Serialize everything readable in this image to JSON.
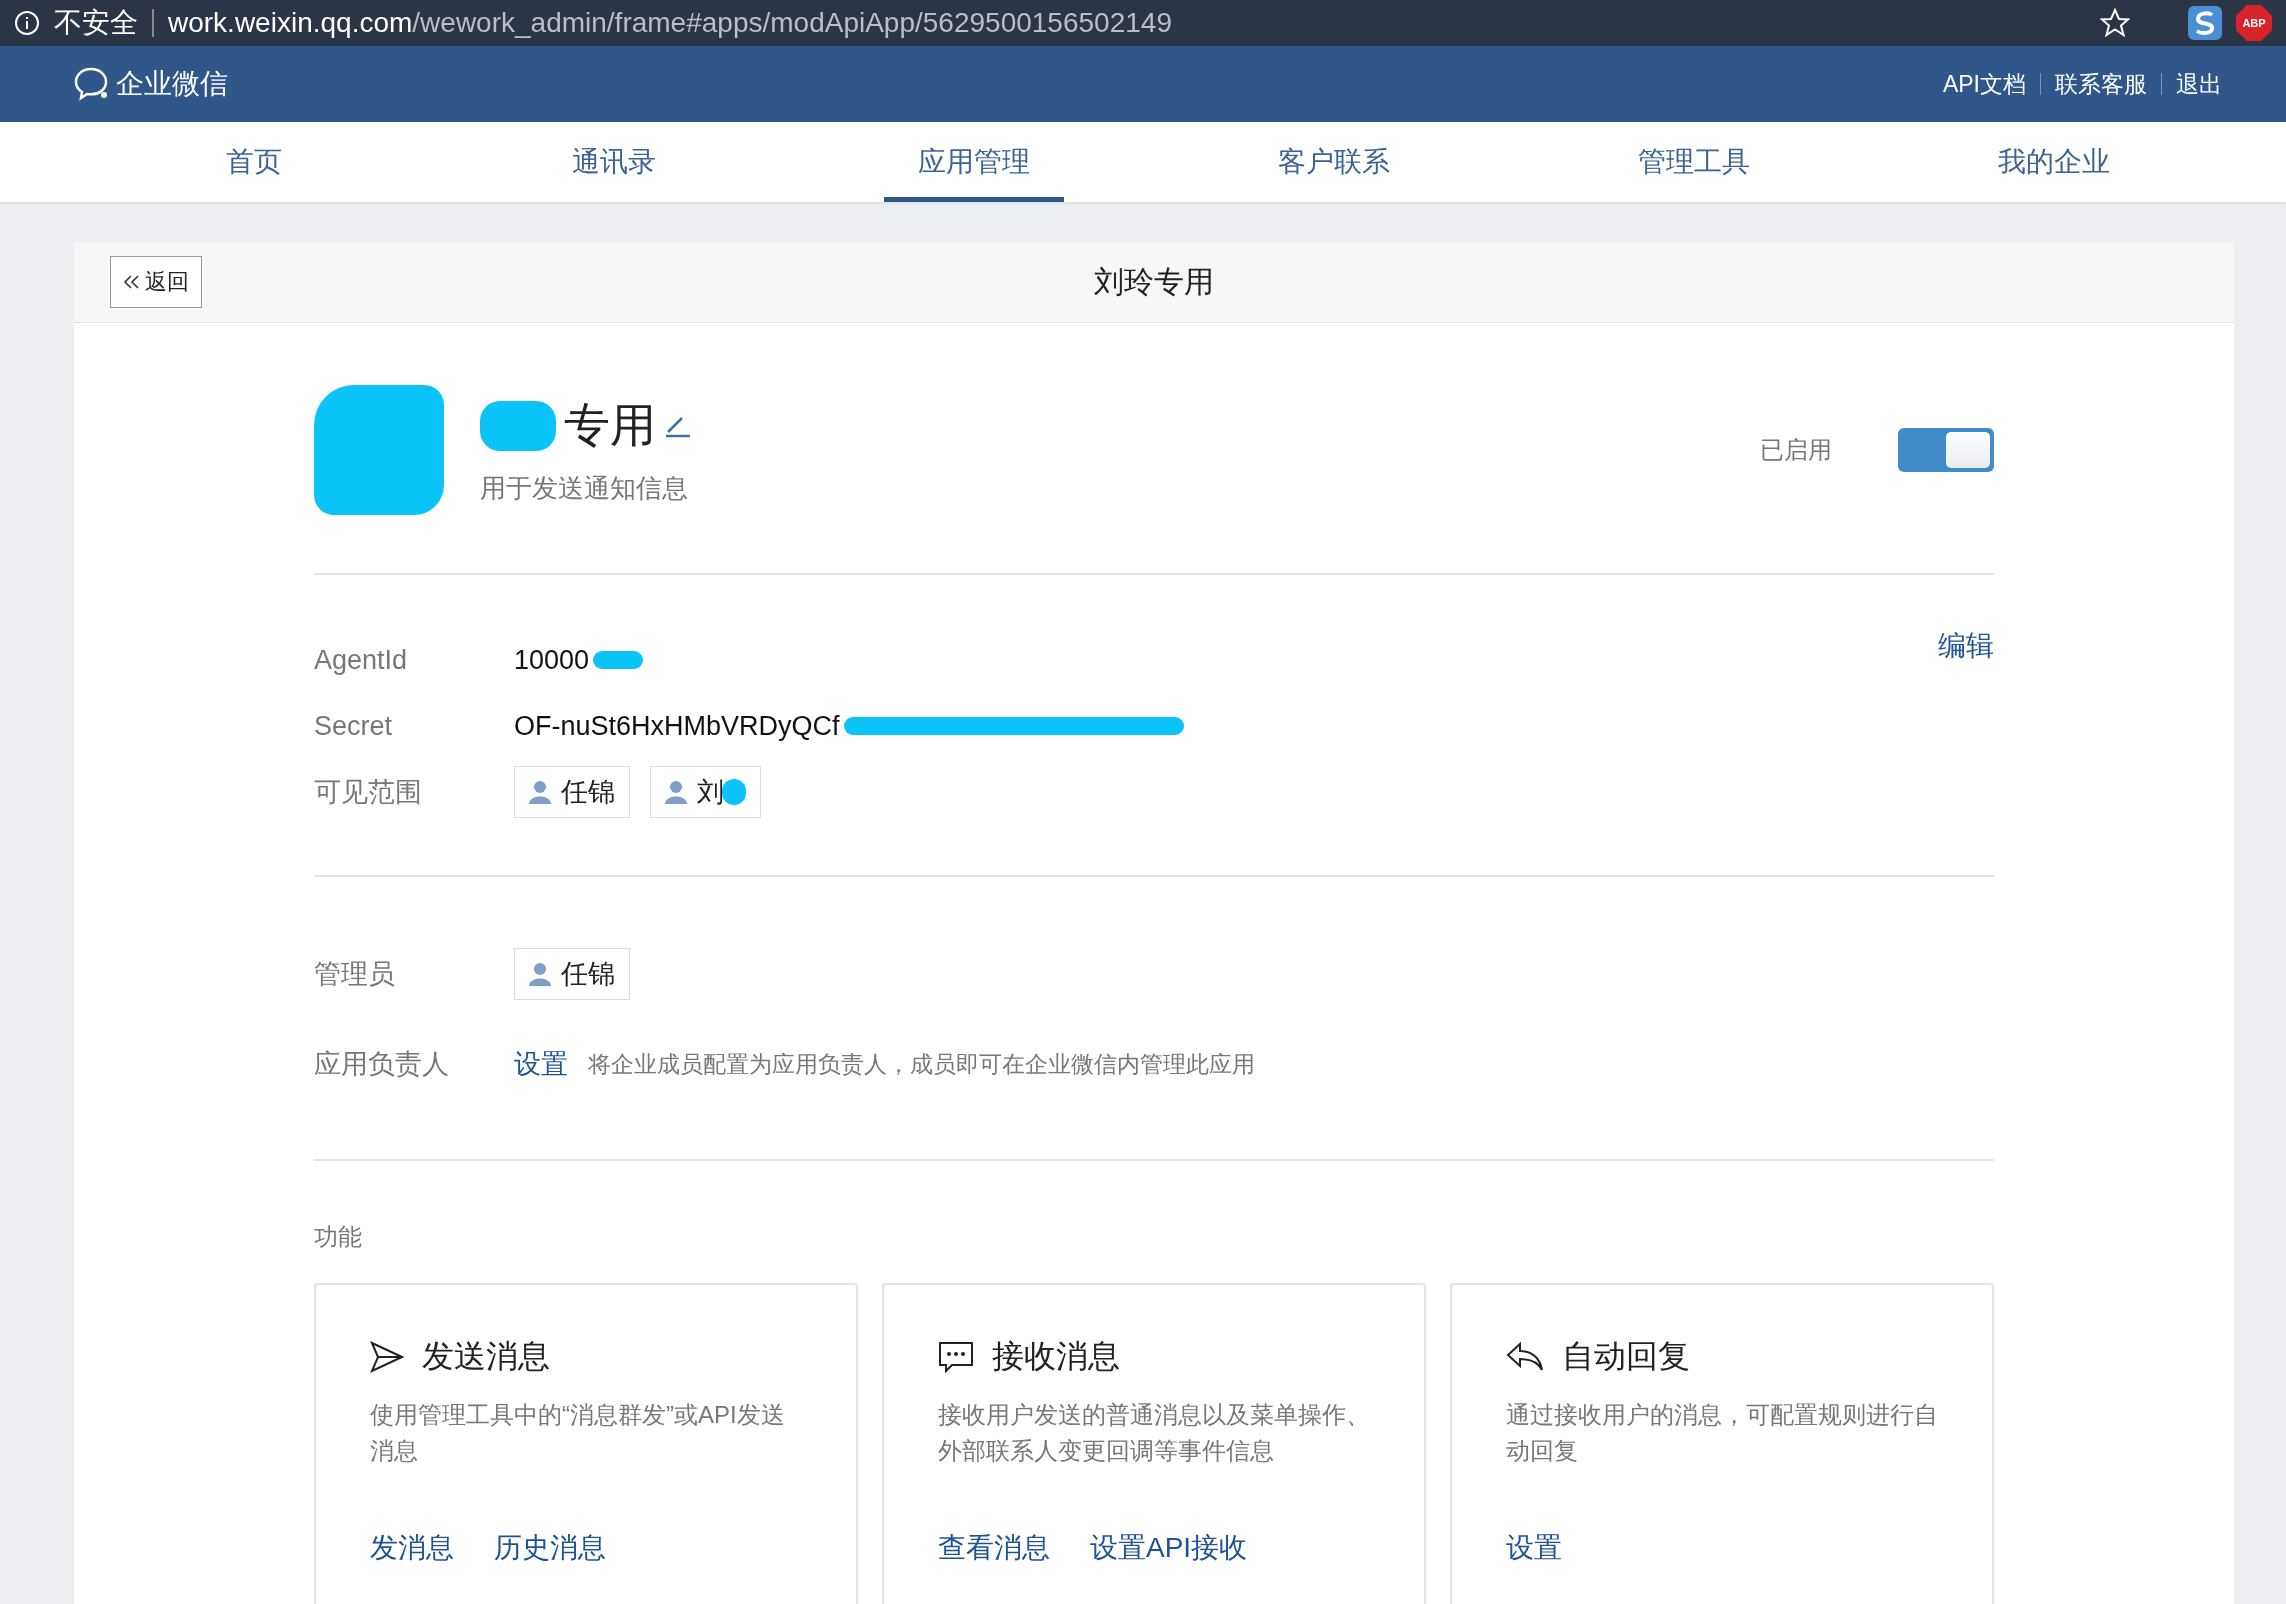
{
  "browser": {
    "security": "不安全",
    "url_host": "work.weixin.qq.com",
    "url_path": "/wework_admin/frame#apps/modApiApp/5629500156502149",
    "extension_badge": "ABP"
  },
  "header": {
    "logo_text": "企业微信",
    "links": [
      "API文档",
      "联系客服",
      "退出"
    ]
  },
  "nav": [
    {
      "label": "首页",
      "selected": false
    },
    {
      "label": "通讯录",
      "selected": false
    },
    {
      "label": "应用管理",
      "selected": true
    },
    {
      "label": "客户联系",
      "selected": false
    },
    {
      "label": "管理工具",
      "selected": false
    },
    {
      "label": "我的企业",
      "selected": false
    }
  ],
  "card": {
    "back": "返回",
    "title": "刘玲专用"
  },
  "app": {
    "name": "专用",
    "description": "用于发送通知信息",
    "status_label": "已启用",
    "enabled": true
  },
  "details": {
    "edit": "编辑",
    "rows": [
      {
        "kind": "text",
        "label": "AgentId",
        "value": "10000"
      },
      {
        "kind": "text",
        "label": "Secret",
        "value": "OF-nuSt6HxHMbVRDyQCf"
      },
      {
        "kind": "members",
        "label": "可见范围",
        "members": [
          "任锦",
          "刘"
        ]
      }
    ]
  },
  "management": {
    "rows": [
      {
        "kind": "members",
        "label": "管理员",
        "members": [
          "任锦"
        ]
      },
      {
        "kind": "setting",
        "label": "应用负责人",
        "link": "设置",
        "hint": "将企业成员配置为应用负责人，成员即可在企业微信内管理此应用"
      }
    ]
  },
  "features": {
    "title": "功能",
    "cards": [
      {
        "kind": "send",
        "title": "发送消息",
        "description": "使用管理工具中的“消息群发”或API发送消息",
        "links": [
          "发消息",
          "历史消息"
        ]
      },
      {
        "kind": "chat",
        "title": "接收消息",
        "description": "接收用户发送的普通消息以及菜单操作、外部联系人变更回调等事件信息",
        "links": [
          "查看消息",
          "设置API接收"
        ]
      },
      {
        "kind": "reply",
        "title": "自动回复",
        "description": "通过接收用户的消息，可配置规则进行自动回复",
        "links": [
          "设置"
        ]
      }
    ]
  }
}
